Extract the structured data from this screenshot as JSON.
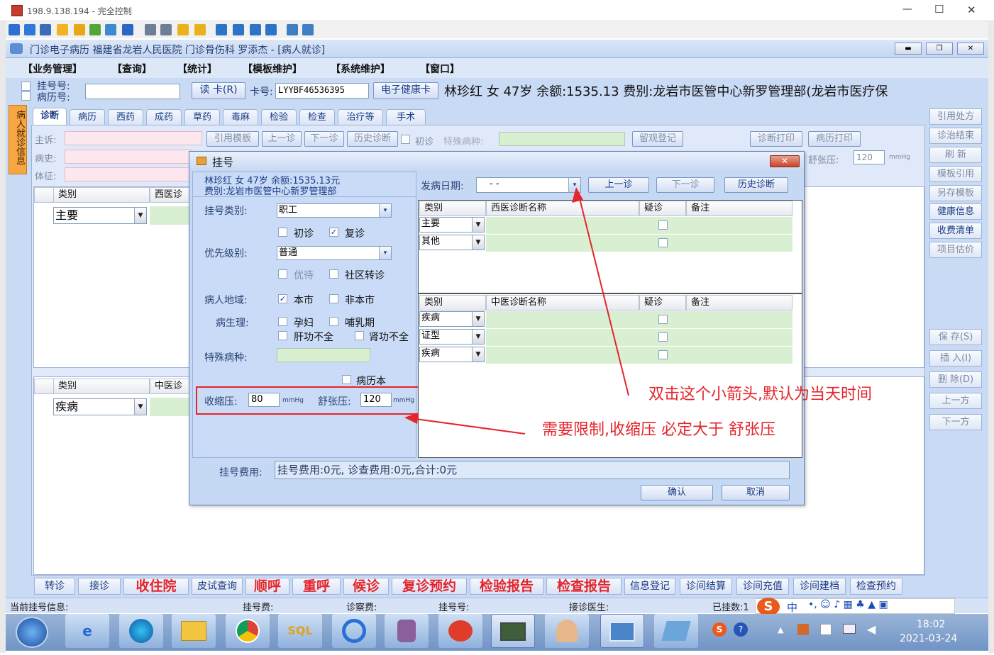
{
  "window": {
    "title": "198.9.138.194 - 完全控制",
    "min": "—",
    "max": "☐",
    "close": "✕"
  },
  "app": {
    "title": "门诊电子病历  福建省龙岩人民医院  门诊骨伤科  罗添杰 - [病人就诊]"
  },
  "menu": [
    "【业务管理】",
    "【查询】",
    "【统计】",
    "【模板维护】",
    "【系统维护】",
    "【窗口】"
  ],
  "patientbar": {
    "reg_label": "挂号号:",
    "record_label": "病历号:",
    "read_card": "读 卡(R)",
    "card_label": "卡号:",
    "card_value": "LYYBF46536395",
    "health_card": "电子健康卡",
    "info": "林珍红  女  47岁  余额:1535.13  费别:龙岩市医管中心新罗管理部(龙岩市医疗保"
  },
  "sidebar_vertical": "病人就诊信息",
  "tabs": [
    "诊断",
    "病历",
    "西药",
    "成药",
    "草药",
    "毒麻",
    "检验",
    "检查",
    "治疗等",
    "手术"
  ],
  "form": {
    "complaint": "主诉:",
    "history": "病史:",
    "sign": "体征:",
    "cite_template": "引用模板",
    "prev": "上一诊",
    "next": "下一诊",
    "history_diag": "历史诊断",
    "first_visit": "初诊",
    "special": "特殊病种:",
    "observe": "留观登记",
    "diag_print": "诊断打印",
    "record_print": "病历打印",
    "diastolic_label": "舒张压:",
    "diastolic_value": "120",
    "unit": "mmHg"
  },
  "main_table_west": {
    "col1": "类别",
    "col2": "西医诊",
    "row1": "主要"
  },
  "main_table_tcm": {
    "col1": "类别",
    "col2": "中医诊",
    "row1": "疾病"
  },
  "right_buttons": [
    "引用处方",
    "诊治结束",
    "刷 新",
    "模板引用",
    "另存模板",
    "健康信息",
    "收费清单",
    "项目估价"
  ],
  "right_buttons2": [
    "保 存(S)",
    "插 入(I)",
    "删 除(D)",
    "上一方",
    "下一方"
  ],
  "dialog": {
    "title": "挂号",
    "close": "✕",
    "patient_line1": "林珍红  女  47岁  余额:1535.13元",
    "patient_line2": "费别:龙岩市医管中心新罗管理部",
    "reg_type_label": "挂号类别:",
    "reg_type_value": "职工",
    "first": "初诊",
    "repeat": "复诊",
    "priority_label": "优先级别:",
    "priority_value": "普通",
    "priority_opt": "优待",
    "community": "社区转诊",
    "region_label": "病人地域:",
    "local": "本市",
    "nonlocal": "非本市",
    "physio_label": "病生理:",
    "pregnant": "孕妇",
    "lactation": "哺乳期",
    "liver": "肝功不全",
    "kidney": "肾功不全",
    "special_label": "特殊病种:",
    "record_book": "病历本",
    "systolic_label": "收缩压:",
    "systolic_value": "80",
    "diastolic_label": "舒张压:",
    "diastolic_value": "120",
    "unit": "mmHg",
    "onset_label": "发病日期:",
    "onset_value": "-   -",
    "prev": "上一诊",
    "next": "下一诊",
    "history": "历史诊断",
    "west_headers": [
      "类别",
      "西医诊断名称",
      "疑诊",
      "备注"
    ],
    "west_rows": [
      "主要",
      "其他"
    ],
    "tcm_headers": [
      "类别",
      "中医诊断名称",
      "疑诊",
      "备注"
    ],
    "tcm_rows": [
      "疾病",
      "证型",
      "疾病"
    ],
    "fee_label": "挂号费用:",
    "fee_value": "挂号费用:0元, 诊查费用:0元,合计:0元",
    "ok": "确认",
    "cancel": "取消"
  },
  "annotations": {
    "arrow_note": "双击这个小箭头,默认为当天时间",
    "limit_note": "需要限制,收缩压 必定大于 舒张压"
  },
  "bottom_buttons": [
    "转诊",
    "接诊",
    "收住院",
    "皮试查询",
    "顺呼",
    "重呼",
    "候诊",
    "复诊预约",
    "检验报告",
    "检查报告",
    "信息登记",
    "诊间结算",
    "诊间充值",
    "诊间建档",
    "检查预约"
  ],
  "status": {
    "current": "当前挂号信息:",
    "fee": "挂号费:",
    "exam": "诊察费:",
    "regno": "挂号号:",
    "doctor": "接诊医生:",
    "count": "已挂数:1"
  },
  "taskbar": {
    "time": "18:02",
    "date": "2021-03-24",
    "ime": "中"
  },
  "colors": {
    "accent": "#1b3c86",
    "red": "#e5242b",
    "panel": "#c9daf5",
    "green": "#d8efd1"
  }
}
